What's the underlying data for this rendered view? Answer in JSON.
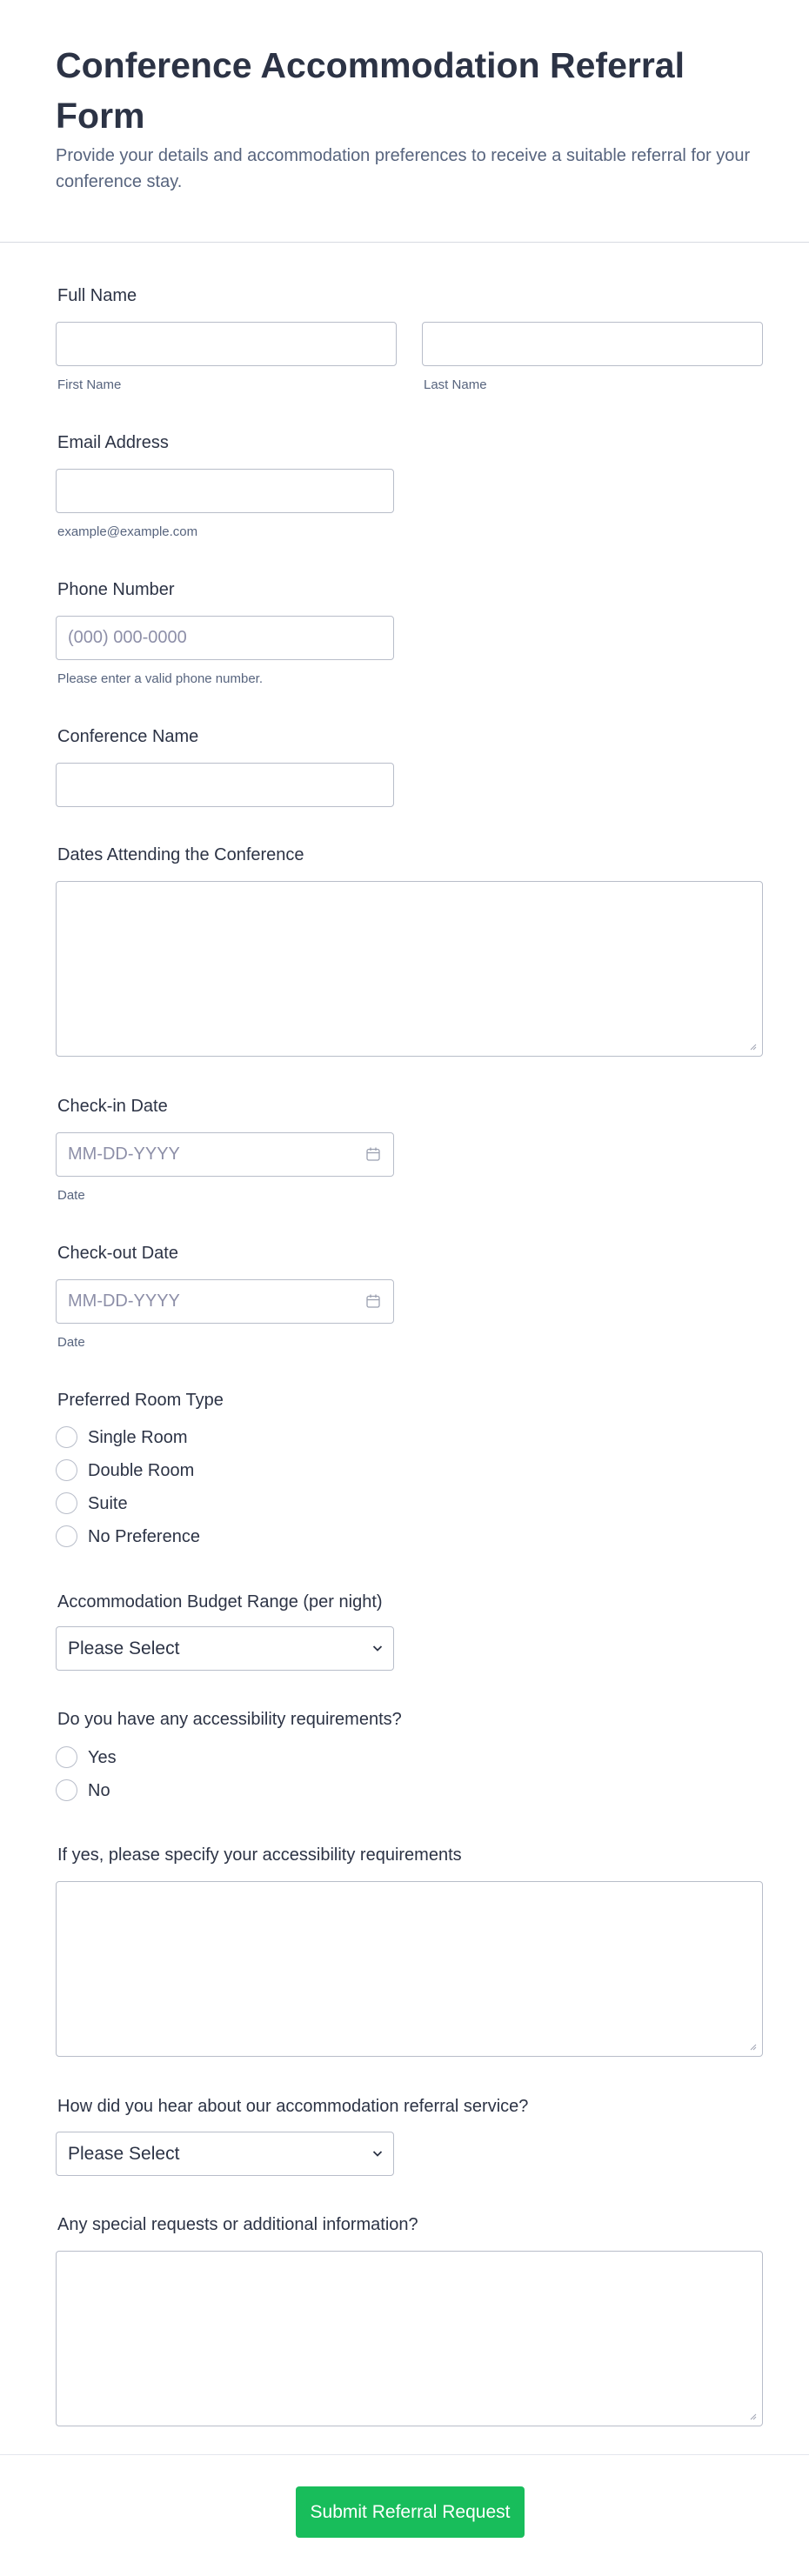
{
  "form": {
    "title": "Conference Accommodation Referral Form",
    "subtitle": "Provide your details and accommodation preferences to receive a suitable referral for your conference stay."
  },
  "fields": {
    "full_name": {
      "label": "Full Name",
      "first_sublabel": "First Name",
      "last_sublabel": "Last Name"
    },
    "email": {
      "label": "Email Address",
      "sublabel": "example@example.com"
    },
    "phone": {
      "label": "Phone Number",
      "placeholder": "(000) 000-0000",
      "sublabel": "Please enter a valid phone number."
    },
    "conference_name": {
      "label": "Conference Name"
    },
    "dates_attending": {
      "label": "Dates Attending the Conference"
    },
    "checkin": {
      "label": "Check-in Date",
      "placeholder": "MM-DD-YYYY",
      "sublabel": "Date"
    },
    "checkout": {
      "label": "Check-out Date",
      "placeholder": "MM-DD-YYYY",
      "sublabel": "Date"
    },
    "room_type": {
      "label": "Preferred Room Type",
      "options": [
        "Single Room",
        "Double Room",
        "Suite",
        "No Preference"
      ]
    },
    "budget": {
      "label": "Accommodation Budget Range (per night)",
      "value": "Please Select"
    },
    "accessibility": {
      "label": "Do you have any accessibility requirements?",
      "options": [
        "Yes",
        "No"
      ]
    },
    "accessibility_details": {
      "label": "If yes, please specify your accessibility requirements"
    },
    "referral_source": {
      "label": "How did you hear about our accommodation referral service?",
      "value": "Please Select"
    },
    "special_requests": {
      "label": "Any special requests or additional information?"
    }
  },
  "submit_label": "Submit Referral Request",
  "colors": {
    "accent": "#18bd5b",
    "text": "#2c3345",
    "muted": "#57647e",
    "border": "#b8bdc9"
  },
  "icons": {
    "date": "calendar-icon",
    "select": "chevron-down-icon"
  }
}
